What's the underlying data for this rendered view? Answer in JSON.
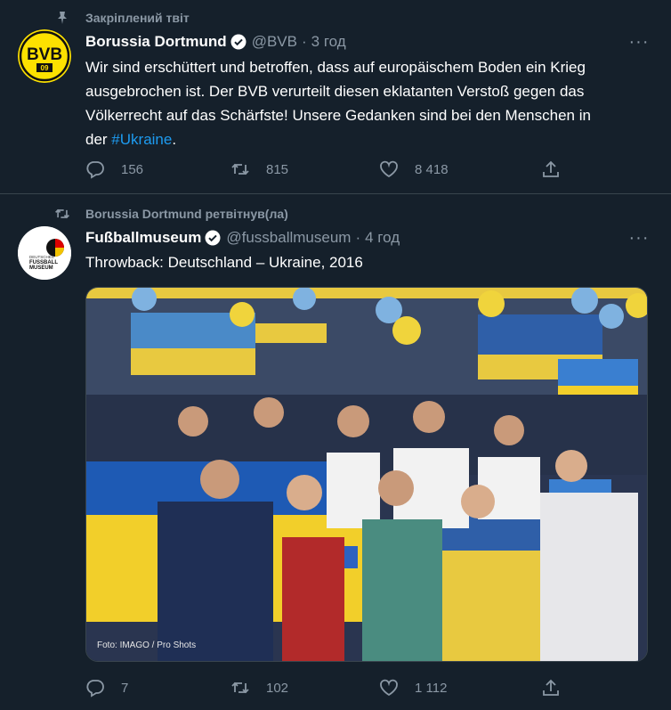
{
  "tweets": [
    {
      "context": "Закріплений твіт",
      "context_icon": "pin-icon",
      "author": "Borussia Dortmund",
      "handle": "@BVB",
      "separator": "·",
      "time": "3 год",
      "text_line1": "Wir sind erschüttert und betroffen, dass auf europäischem Boden ein Krieg",
      "text_line2": "ausgebrochen ist. Der BVB verurteilt diesen eklatanten Verstoß gegen das",
      "text_line3": "Völkerrecht auf das Schärfste! Unsere Gedanken sind bei den Menschen in",
      "text_line4_prefix": "der ",
      "hashtag": "#Ukraine",
      "text_line4_suffix": ".",
      "replies": "156",
      "retweets": "815",
      "likes": "8 418",
      "more": "···",
      "avatar_text": "BVB",
      "avatar_sub": "09"
    },
    {
      "context": "Borussia Dortmund ретвітнув(ла)",
      "context_icon": "retweet-icon",
      "author": "Fußballmuseum",
      "handle": "@fussballmuseum",
      "separator": "·",
      "time": "4 год",
      "text": "Throwback: Deutschland – Ukraine, 2016",
      "photo_credit": "Foto: IMAGO / Pro Shots",
      "replies": "7",
      "retweets": "102",
      "likes": "1 112",
      "more": "···",
      "avatar_line1": "DEUTSCHES",
      "avatar_line2": "FUSSBALL",
      "avatar_line3": "MUSEUM"
    }
  ],
  "colors": {
    "background": "#15202b",
    "text": "#ffffff",
    "secondary": "#8b98a5",
    "link": "#1d9bf0",
    "bvb_yellow": "#fde100",
    "ukraine_blue": "#1e5ab4",
    "ukraine_yellow": "#f2cf2a"
  }
}
